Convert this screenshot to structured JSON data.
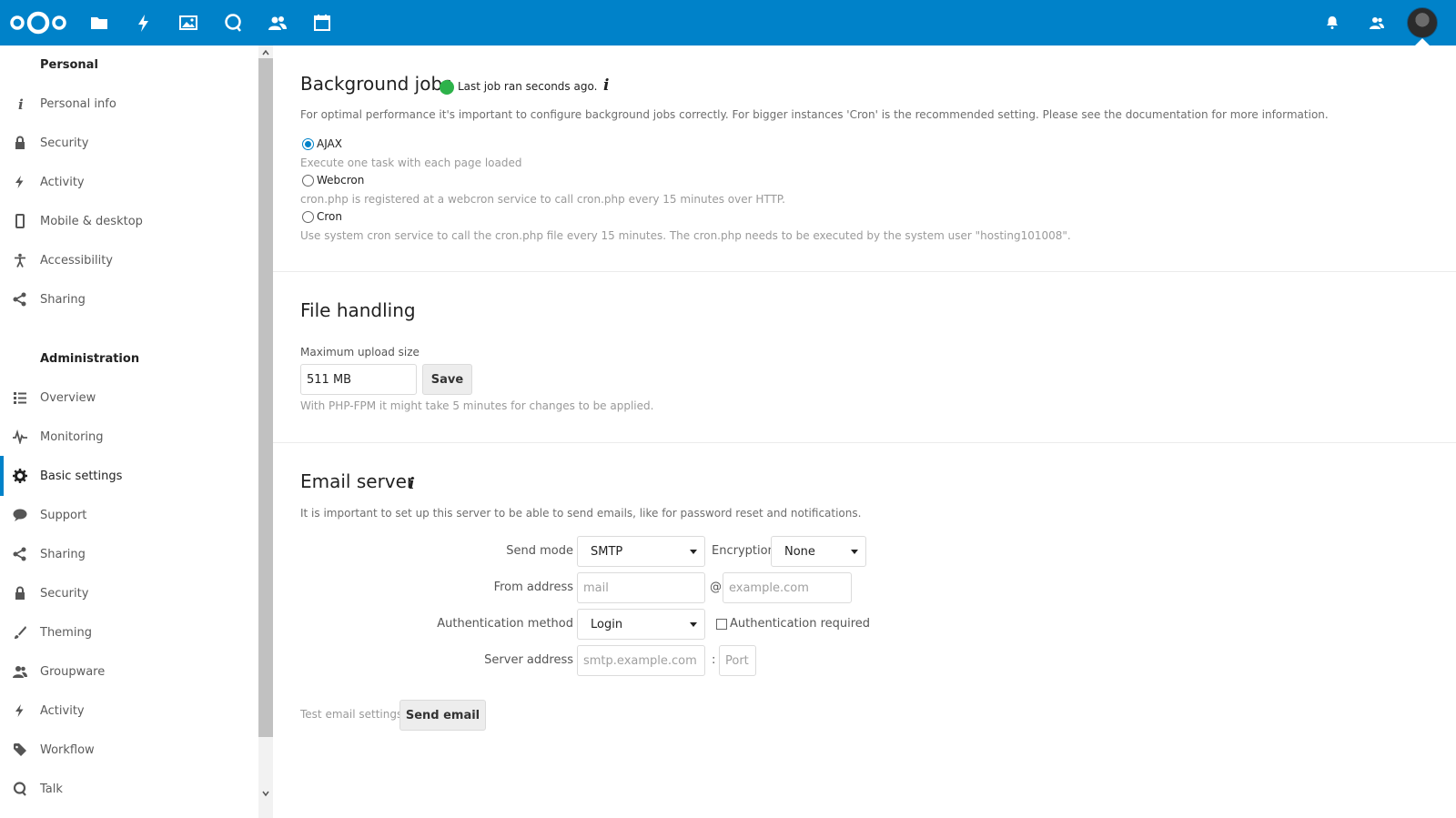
{
  "header": {
    "apps": [
      {
        "name": "files-icon"
      },
      {
        "name": "activity-icon"
      },
      {
        "name": "gallery-icon"
      },
      {
        "name": "talk-icon"
      },
      {
        "name": "contacts-icon"
      },
      {
        "name": "calendar-icon"
      }
    ],
    "accent": "#0082c9"
  },
  "sidebar": {
    "personal_heading": "Personal",
    "admin_heading": "Administration",
    "personal_items": [
      {
        "label": "Personal info",
        "icon": "info-icon"
      },
      {
        "label": "Security",
        "icon": "lock-icon"
      },
      {
        "label": "Activity",
        "icon": "lightning-icon"
      },
      {
        "label": "Mobile & desktop",
        "icon": "phone-icon"
      },
      {
        "label": "Accessibility",
        "icon": "accessibility-icon"
      },
      {
        "label": "Sharing",
        "icon": "share-icon"
      }
    ],
    "admin_items": [
      {
        "label": "Overview",
        "icon": "list-icon"
      },
      {
        "label": "Monitoring",
        "icon": "pulse-icon"
      },
      {
        "label": "Basic settings",
        "icon": "gear-icon",
        "active": true
      },
      {
        "label": "Support",
        "icon": "chat-bubble-icon"
      },
      {
        "label": "Sharing",
        "icon": "share-icon"
      },
      {
        "label": "Security",
        "icon": "lock-icon"
      },
      {
        "label": "Theming",
        "icon": "brush-icon"
      },
      {
        "label": "Groupware",
        "icon": "group-icon"
      },
      {
        "label": "Activity",
        "icon": "lightning-icon"
      },
      {
        "label": "Workflow",
        "icon": "tag-icon"
      },
      {
        "label": "Talk",
        "icon": "talk-icon"
      }
    ]
  },
  "background_jobs": {
    "title": "Background jobs",
    "status": "Last job ran seconds ago.",
    "status_color": "#2db24a",
    "description": "For optimal performance it's important to configure background jobs correctly. For bigger instances 'Cron' is the recommended setting. Please see the documentation for more information.",
    "options": [
      {
        "label": "AJAX",
        "hint": "Execute one task with each page loaded",
        "checked": true
      },
      {
        "label": "Webcron",
        "hint": "cron.php is registered at a webcron service to call cron.php every 15 minutes over HTTP.",
        "checked": false
      },
      {
        "label": "Cron",
        "hint": "Use system cron service to call the cron.php file every 15 minutes. The cron.php needs to be executed by the system user \"hosting101008\".",
        "checked": false
      }
    ]
  },
  "file_handling": {
    "title": "File handling",
    "max_upload_label": "Maximum upload size",
    "max_upload_value": "511 MB",
    "save_label": "Save",
    "hint": "With PHP-FPM it might take 5 minutes for changes to be applied."
  },
  "email_server": {
    "title": "Email server",
    "description": "It is important to set up this server to be able to send emails, like for password reset and notifications.",
    "send_mode_label": "Send mode",
    "send_mode_value": "SMTP",
    "encryption_label": "Encryption",
    "encryption_value": "None",
    "from_address_label": "From address",
    "from_address_placeholder": "mail",
    "at_sign": "@",
    "domain_placeholder": "example.com",
    "auth_method_label": "Authentication method",
    "auth_method_value": "Login",
    "auth_required_label": "Authentication required",
    "server_address_label": "Server address",
    "server_placeholder": "smtp.example.com",
    "colon": ":",
    "port_placeholder": "Port",
    "test_label": "Test email settings",
    "send_email_label": "Send email"
  }
}
